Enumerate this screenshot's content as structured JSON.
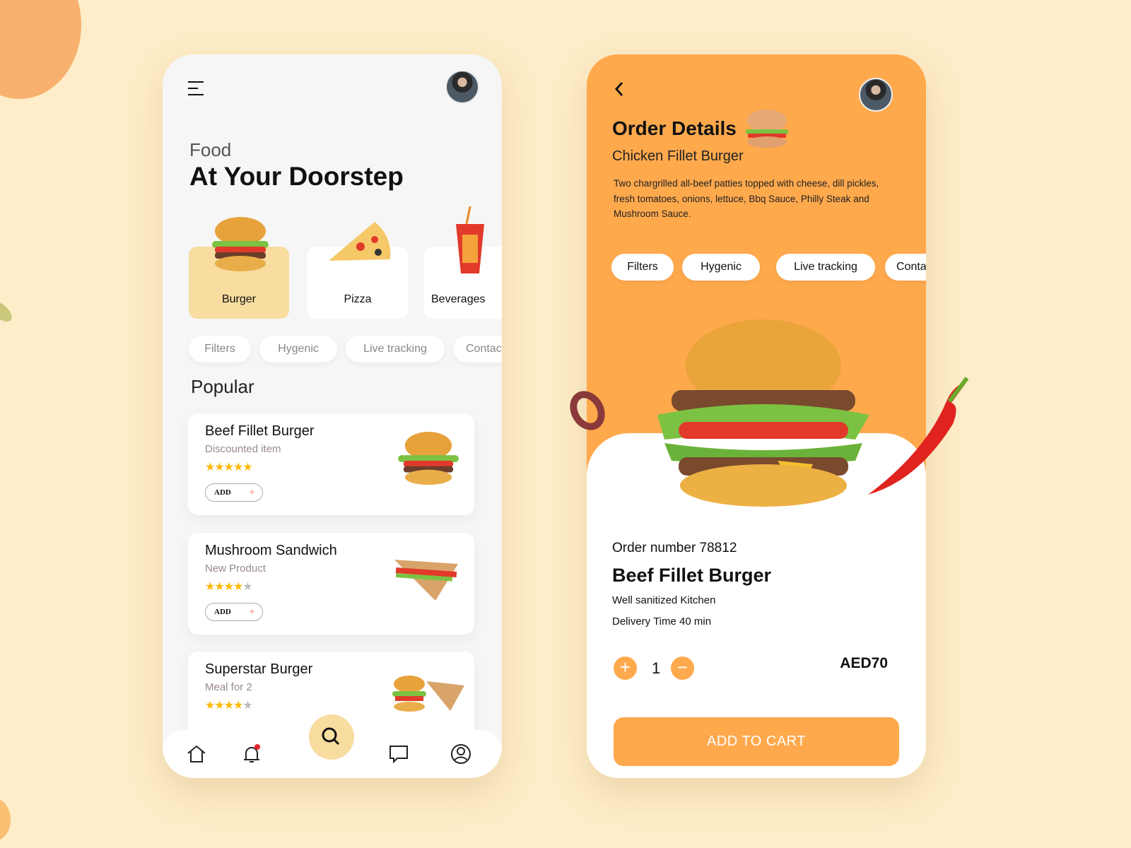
{
  "left": {
    "subtitle": "Food",
    "title": "At Your Doorstep",
    "categories": [
      {
        "label": "Burger",
        "active": true
      },
      {
        "label": "Pizza",
        "active": false
      },
      {
        "label": "Beverages",
        "active": false
      }
    ],
    "chips": [
      "Filters",
      "Hygenic",
      "Live tracking",
      "Contact"
    ],
    "popular_heading": "Popular",
    "items": [
      {
        "name": "Beef Fillet Burger",
        "tag": "Discounted item",
        "rating": 5,
        "add_label": "ADD"
      },
      {
        "name": "Mushroom Sandwich",
        "tag": "New Product",
        "rating": 4,
        "add_label": "ADD"
      },
      {
        "name": "Superstar Burger",
        "tag": "Meal for 2",
        "rating": 4
      }
    ],
    "star": "★",
    "plus": "+"
  },
  "right": {
    "title": "Order Details",
    "subtitle": "Chicken Fillet Burger",
    "description": "Two chargrilled all-beef patties topped with cheese, dill pickles, fresh tomatoes, onions, lettuce, Bbq Sauce, Philly Steak and Mushroom Sauce.",
    "chips": [
      "Filters",
      "Hygenic",
      "Live tracking",
      "Contact"
    ],
    "order_number": "Order number 78812",
    "product_name": "Beef Fillet Burger",
    "feature": "Well sanitized Kitchen",
    "delivery": "Delivery Time 40 min",
    "quantity": "1",
    "price": "AED70",
    "add_to_cart": "ADD TO CART"
  },
  "colors": {
    "background": "#FEEDC8",
    "accent": "#FFA94D",
    "category_active": "#F8DCA0",
    "star": "#FFB800",
    "notification": "#E8232B"
  }
}
